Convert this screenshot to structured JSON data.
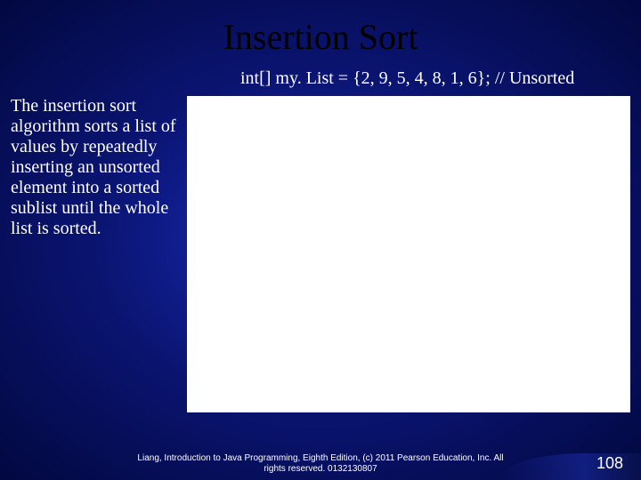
{
  "title": "Insertion Sort",
  "code_line": "int[] my. List = {2, 9, 5, 4, 8, 1, 6}; // Unsorted",
  "description": "The insertion sort algorithm sorts a list of values by repeatedly inserting an unsorted element into a sorted sublist until the whole list is sorted.",
  "footer_line1": "Liang, Introduction to Java Programming, Eighth Edition, (c) 2011 Pearson Education, Inc. All",
  "footer_line2": "rights reserved. 0132130807",
  "page_number": "108",
  "chart_data": {
    "type": "table",
    "note": "Diagram area is blank white in this slide (no visible sort steps rendered).",
    "unsorted_list": [
      2,
      9,
      5,
      4,
      8,
      1,
      6
    ]
  }
}
